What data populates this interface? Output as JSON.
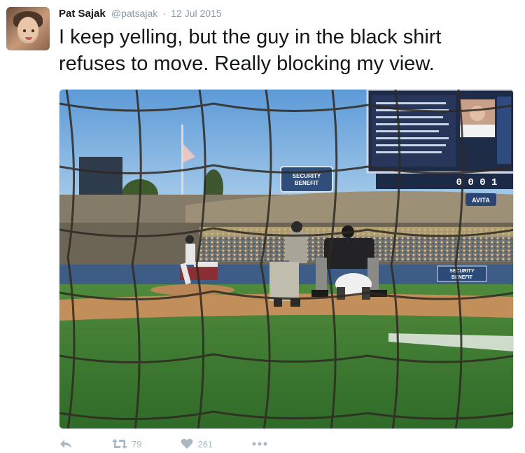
{
  "tweet": {
    "author_name": "Pat Sajak",
    "handle": "@patsajak",
    "separator": "·",
    "date": "12 Jul 2015",
    "text": "I keep yelling, but the guy in the black shirt refuses to move. Really blocking my view."
  },
  "media": {
    "stadium_signs": {
      "security_benefit_top": "SECURITY BENEFIT",
      "security_benefit_wall": "SECURITY BENEFIT",
      "avita": "AVITA",
      "scoreboard_digits": "0 0 0 1"
    }
  },
  "actions": {
    "reply_icon": "reply-arrow-icon",
    "retweet_icon": "retweet-icon",
    "retweet_count": "79",
    "like_icon": "heart-icon",
    "like_count": "261",
    "more_icon": "more-dots-icon"
  },
  "colors": {
    "name": "#14171a",
    "meta": "#8899a6",
    "action": "#aab8c2"
  }
}
